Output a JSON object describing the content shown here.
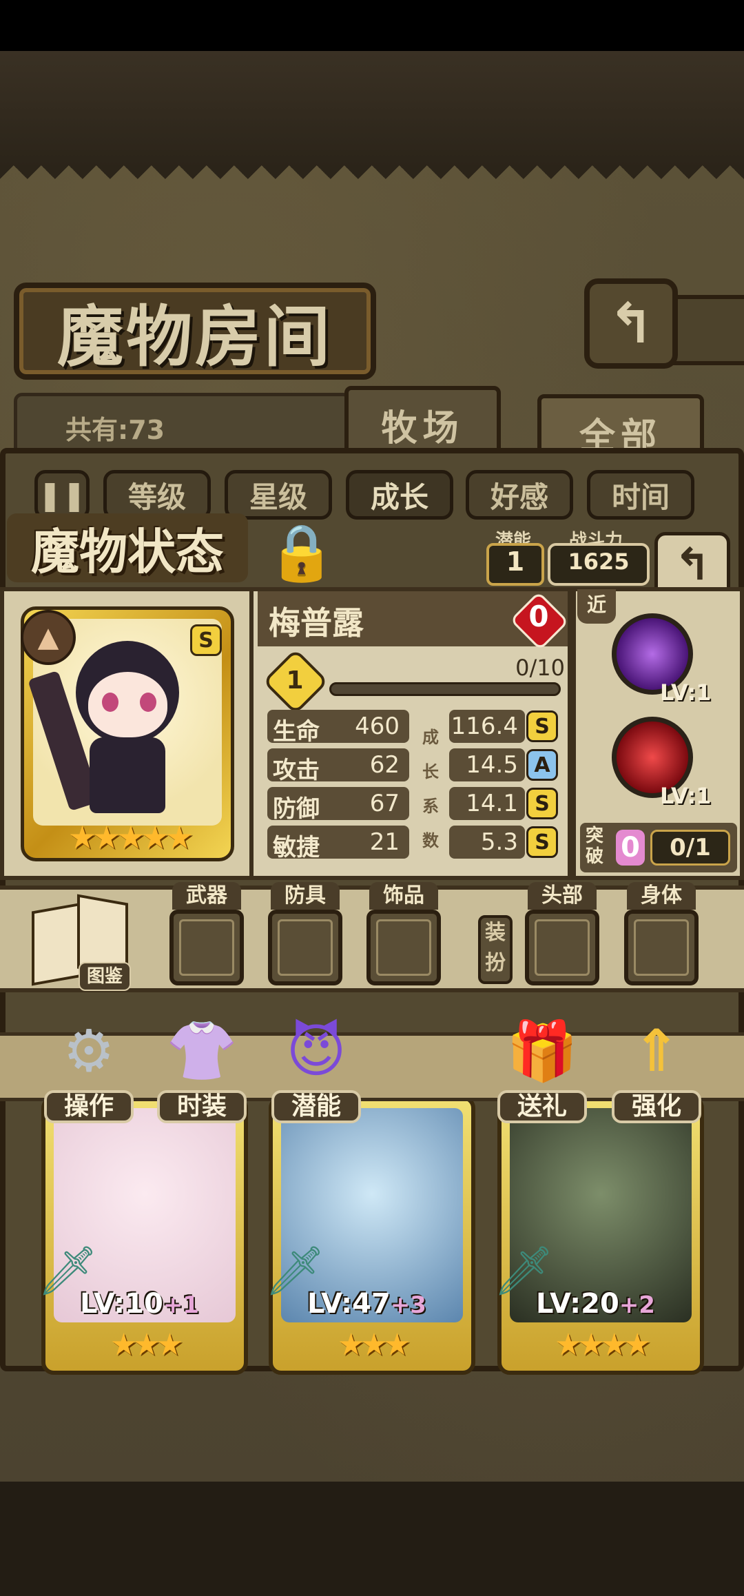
{
  "room": {
    "title": "魔物房间",
    "total_label": "共有:73",
    "tabs": [
      {
        "label": "牧场",
        "active": false
      },
      {
        "label": "全部",
        "active": true
      }
    ],
    "back_icon": "return-icon"
  },
  "sort": {
    "pause_icon": "pause-icon",
    "options": [
      {
        "label": "等级",
        "active": false
      },
      {
        "label": "星级",
        "active": false
      },
      {
        "label": "成长",
        "active": true
      },
      {
        "label": "好感",
        "active": false
      },
      {
        "label": "时间",
        "active": false
      }
    ]
  },
  "status": {
    "title": "魔物状态",
    "lock_icon": "lock-icon",
    "potential_label": "潜能",
    "potential_value": "1",
    "power_label": "战斗力",
    "power_value": "1625",
    "undo_icon": "undo-icon"
  },
  "monster": {
    "name": "梅普露",
    "affection": "0",
    "rank": "S",
    "stars": 5,
    "element_icon": "mountain-element-icon",
    "level": "1",
    "exp_text": "0/10",
    "exp_progress": 0,
    "growth_chars": [
      "成",
      "长",
      "系",
      "数"
    ],
    "stats": [
      {
        "name": "生命",
        "value": "460",
        "growth": "116.4",
        "grade": "S"
      },
      {
        "name": "攻击",
        "value": "62",
        "growth": "14.5",
        "grade": "A"
      },
      {
        "name": "防御",
        "value": "67",
        "growth": "14.1",
        "grade": "S"
      },
      {
        "name": "敏捷",
        "value": "21",
        "growth": "5.3",
        "grade": "S"
      }
    ]
  },
  "skills": {
    "range_tag": "近",
    "items": [
      {
        "lv": "LV:1",
        "color": "#5b1f8c"
      },
      {
        "lv": "LV:1",
        "color": "#a8101a"
      }
    ],
    "break_label": "突破",
    "break_value": "0",
    "break_progress": "0/1"
  },
  "equipment": {
    "book_label": "图鉴",
    "dress_label": "装扮",
    "slots": [
      "武器",
      "防具",
      "饰品",
      "头部",
      "身体"
    ]
  },
  "actions": [
    {
      "label": "操作",
      "icon": "gear-icon"
    },
    {
      "label": "时装",
      "icon": "outfit-icon"
    },
    {
      "label": "潜能",
      "icon": "demon-icon"
    },
    {
      "label": "送礼",
      "icon": "gift-icon"
    },
    {
      "label": "强化",
      "icon": "upgrade-arrows-icon"
    }
  ],
  "cards": [
    {
      "lv": "LV:10",
      "plus": "+1",
      "stars": 3
    },
    {
      "lv": "LV:47",
      "plus": "+3",
      "stars": 3
    },
    {
      "lv": "LV:20",
      "plus": "+2",
      "stars": 4
    }
  ]
}
